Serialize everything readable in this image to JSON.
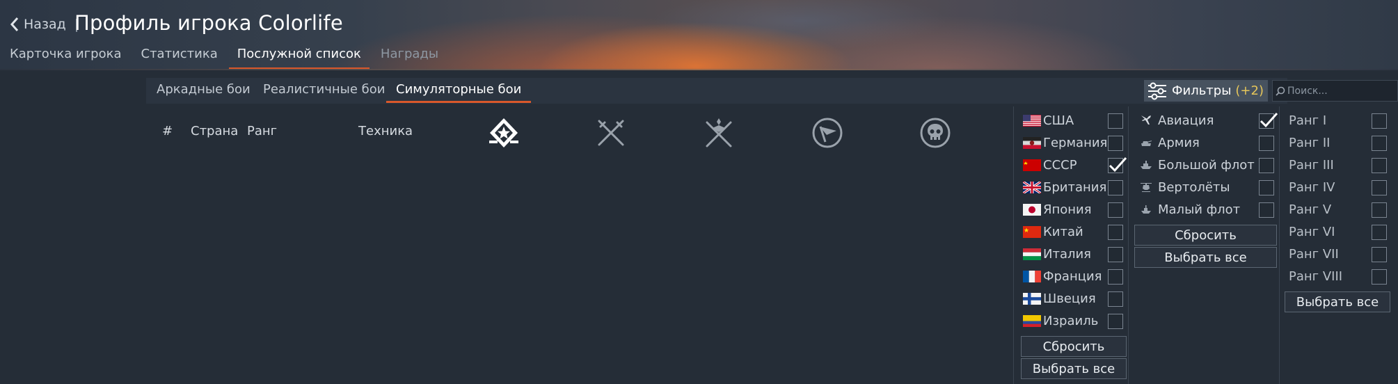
{
  "header": {
    "back_label": "Назад",
    "separator": "|",
    "title": "Профиль игрока Colorlife",
    "tabs": [
      {
        "label": "Карточка игрока",
        "state": "normal"
      },
      {
        "label": "Статистика",
        "state": "normal"
      },
      {
        "label": "Послужной список",
        "state": "active"
      },
      {
        "label": "Награды",
        "state": "disabled"
      }
    ]
  },
  "mode_tabs": [
    {
      "label": "Аркадные бои",
      "active": false
    },
    {
      "label": "Реалистичные бои",
      "active": false
    },
    {
      "label": "Симуляторные бои",
      "active": true
    }
  ],
  "filters": {
    "label": "Фильтры",
    "count": "(+2)",
    "search_placeholder": "Поиск..."
  },
  "table": {
    "columns": [
      "#",
      "Страна",
      "Ранг",
      "Техника"
    ],
    "stat_icons": [
      "victories-icon",
      "air-kills-icon",
      "ground-kills-icon",
      "captures-icon",
      "deaths-icon"
    ]
  },
  "countries": {
    "items": [
      {
        "label": "США",
        "flag": "usa",
        "checked": false
      },
      {
        "label": "Германия",
        "flag": "germany",
        "checked": false
      },
      {
        "label": "СССР",
        "flag": "ussr",
        "checked": true
      },
      {
        "label": "Британия",
        "flag": "britain",
        "checked": false
      },
      {
        "label": "Япония",
        "flag": "japan",
        "checked": false
      },
      {
        "label": "Китай",
        "flag": "china",
        "checked": false
      },
      {
        "label": "Италия",
        "flag": "italy",
        "checked": false
      },
      {
        "label": "Франция",
        "flag": "france",
        "checked": false
      },
      {
        "label": "Швеция",
        "flag": "sweden",
        "checked": false
      },
      {
        "label": "Израиль",
        "flag": "israel",
        "checked": false
      }
    ],
    "reset_label": "Сбросить",
    "select_all_label": "Выбрать все"
  },
  "types": {
    "items": [
      {
        "label": "Авиация",
        "icon": "aviation-icon",
        "checked": true
      },
      {
        "label": "Армия",
        "icon": "tank-icon",
        "checked": false
      },
      {
        "label": "Большой флот",
        "icon": "ship-icon",
        "checked": false
      },
      {
        "label": "Вертолёты",
        "icon": "helicopter-icon",
        "checked": false
      },
      {
        "label": "Малый флот",
        "icon": "boat-icon",
        "checked": false
      }
    ],
    "reset_label": "Сбросить",
    "select_all_label": "Выбрать все"
  },
  "ranks": {
    "items": [
      {
        "label": "Ранг I",
        "checked": false
      },
      {
        "label": "Ранг II",
        "checked": false
      },
      {
        "label": "Ранг III",
        "checked": false
      },
      {
        "label": "Ранг IV",
        "checked": false
      },
      {
        "label": "Ранг V",
        "checked": false
      },
      {
        "label": "Ранг VI",
        "checked": false
      },
      {
        "label": "Ранг VII",
        "checked": false
      },
      {
        "label": "Ранг VIII",
        "checked": false
      }
    ],
    "select_all_label": "Выбрать все"
  },
  "colors": {
    "accent": "#d9582b",
    "count": "#e6c65a",
    "background": "#252d37"
  }
}
